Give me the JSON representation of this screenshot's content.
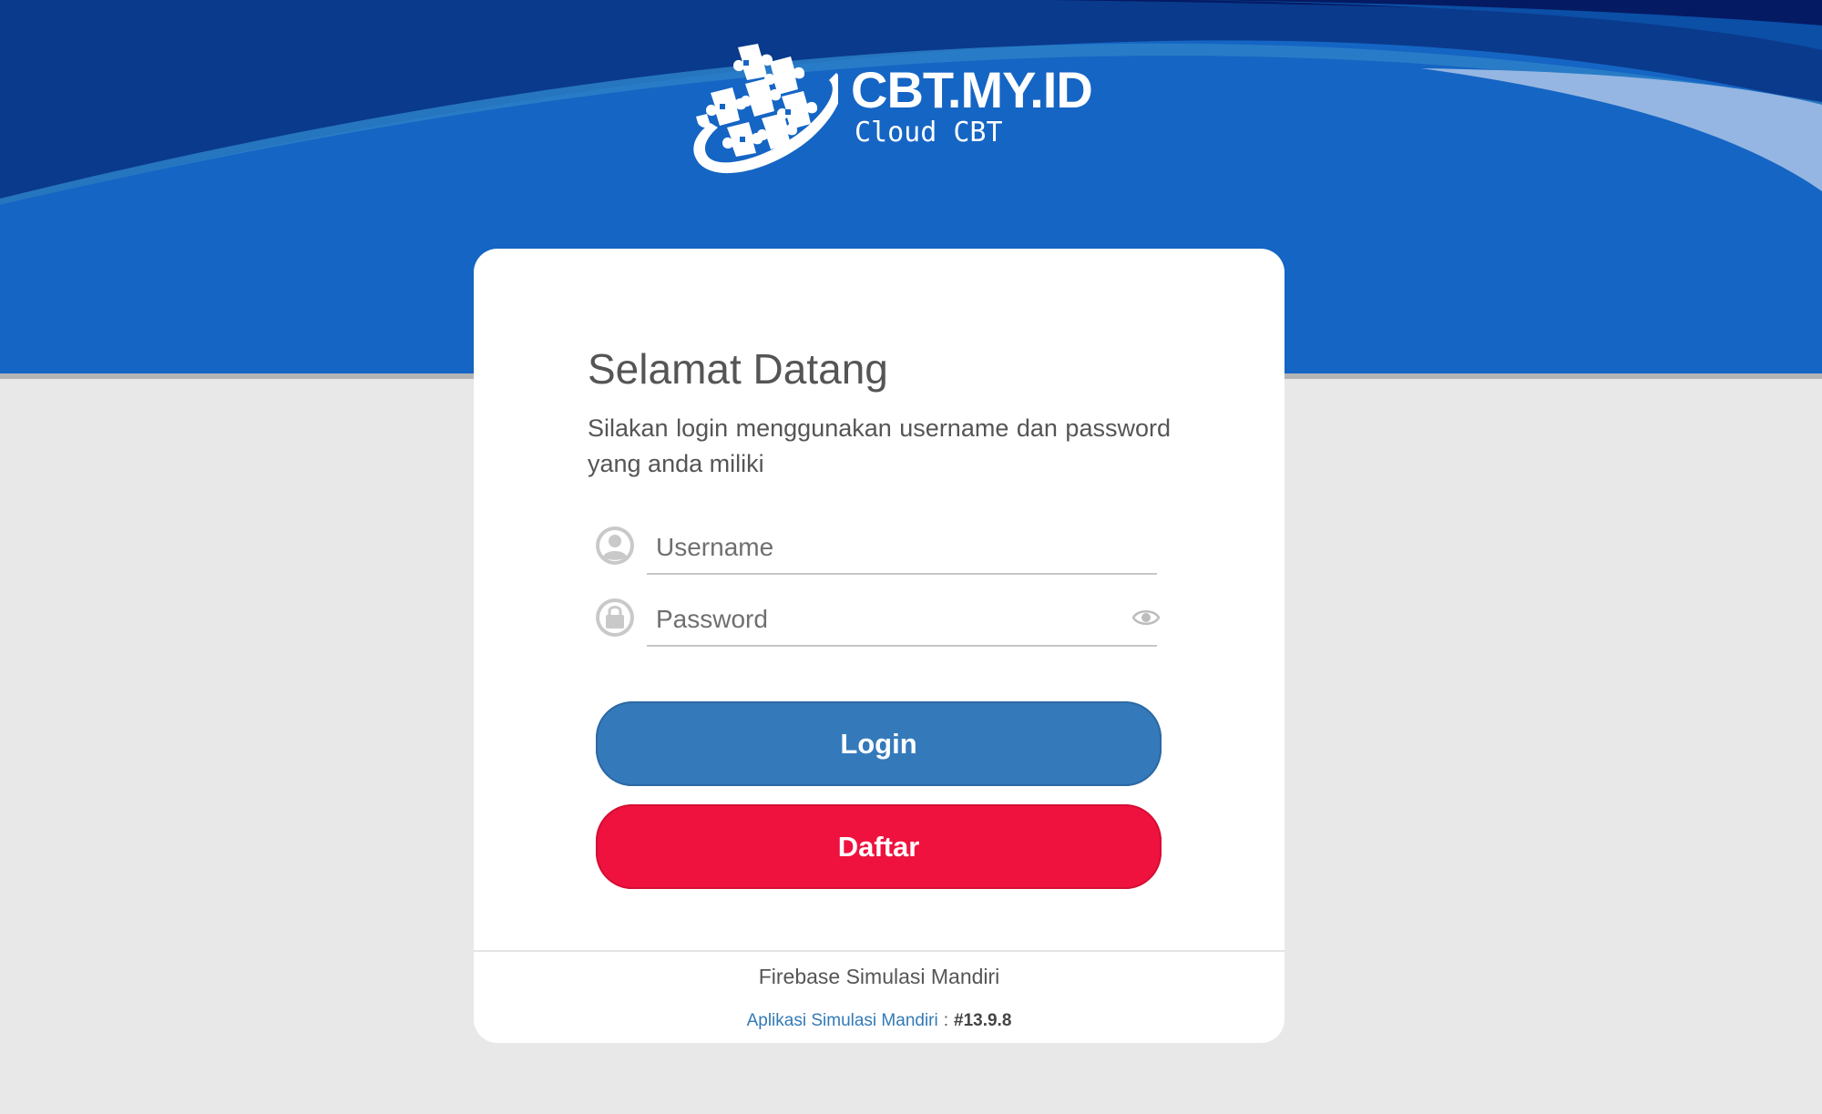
{
  "brand": {
    "title": "CBT.MY.ID",
    "subtitle": "Cloud CBT",
    "logo_icon": "puzzle-globe-icon"
  },
  "login": {
    "heading": "Selamat Datang",
    "description": "Silakan login menggunakan username dan password yang anda miliki",
    "username": {
      "placeholder": "Username",
      "value": "",
      "icon": "user-icon"
    },
    "password": {
      "placeholder": "Password",
      "value": "",
      "icon": "lock-icon",
      "toggle_icon": "eye-icon"
    },
    "login_label": "Login",
    "register_label": "Daftar"
  },
  "footer": {
    "title": "Firebase Simulasi Mandiri",
    "app_link": "Aplikasi Simulasi Mandiri",
    "separator": ":",
    "version": "#13.9.8"
  },
  "colors": {
    "header_blue": "#1565c4",
    "header_dark": "#0a3a8c",
    "login_button": "#347abb",
    "register_button": "#ef123e",
    "link": "#337ab7",
    "page_background": "#e8e8e8"
  }
}
